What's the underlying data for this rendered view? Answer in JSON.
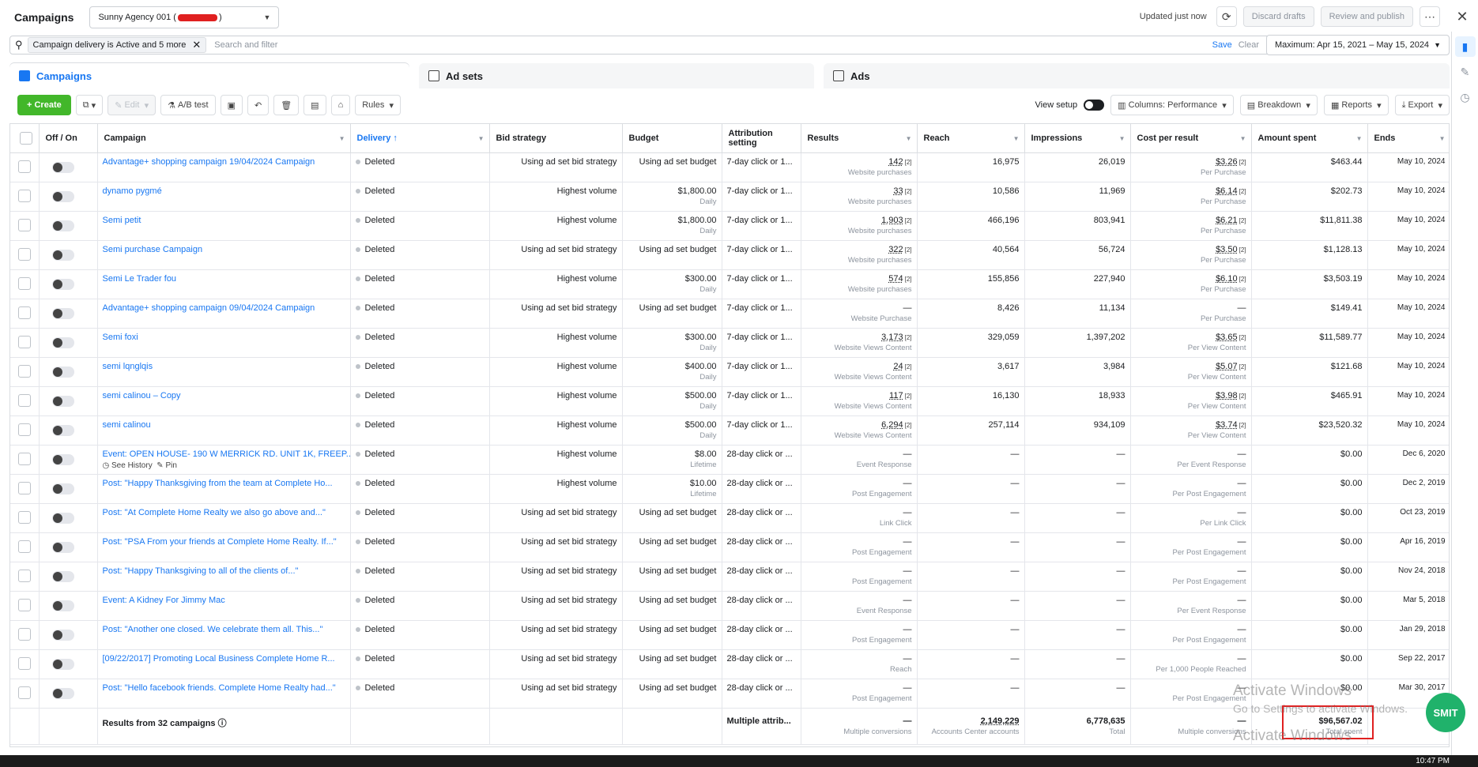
{
  "header": {
    "title": "Campaigns",
    "account": "Sunny Agency 001 (",
    "account_suffix": ")",
    "updated": "Updated just now",
    "discard": "Discard drafts",
    "review": "Review and publish"
  },
  "filter": {
    "chip_prefix": "Campaign delivery",
    "chip_is": "is",
    "chip_value": "Active and 5 more",
    "placeholder": "Search and filter",
    "save": "Save",
    "clear": "Clear",
    "date": "Maximum: Apr 15, 2021 – May 15, 2024"
  },
  "tabs": {
    "campaigns": "Campaigns",
    "adsets": "Ad sets",
    "ads": "Ads"
  },
  "toolbar": {
    "create": "+ Create",
    "edit": "Edit",
    "abtest": "A/B test",
    "rules": "Rules",
    "view_setup": "View setup",
    "columns": "Columns: Performance",
    "breakdown": "Breakdown",
    "reports": "Reports",
    "export": "Export"
  },
  "columns": [
    "Off / On",
    "Campaign",
    "Delivery",
    "Bid strategy",
    "Budget",
    "Attribution setting",
    "Results",
    "Reach",
    "Impressions",
    "Cost per result",
    "Amount spent",
    "Ends"
  ],
  "rows": [
    {
      "name": "Advantage+ shopping campaign 19/04/2024 Campaign",
      "delivery": "Deleted",
      "bid": "Using ad set bid strategy",
      "budget": "Using ad set budget",
      "budget_sub": "",
      "attr": "7-day click or 1...",
      "results": "142",
      "results_sub": "Website purchases",
      "reach": "16,975",
      "impr": "26,019",
      "cpr": "$3.26",
      "cpr_sub": "Per Purchase",
      "spent": "$463.44",
      "ends": "May 10, 2024"
    },
    {
      "name": "dynamo pygmé",
      "delivery": "Deleted",
      "bid": "Highest volume",
      "budget": "$1,800.00",
      "budget_sub": "Daily",
      "attr": "7-day click or 1...",
      "results": "33",
      "results_sub": "Website purchases",
      "reach": "10,586",
      "impr": "11,969",
      "cpr": "$6.14",
      "cpr_sub": "Per Purchase",
      "spent": "$202.73",
      "ends": "May 10, 2024"
    },
    {
      "name": "Semi petit",
      "delivery": "Deleted",
      "bid": "Highest volume",
      "budget": "$1,800.00",
      "budget_sub": "Daily",
      "attr": "7-day click or 1...",
      "results": "1,903",
      "results_sub": "Website purchases",
      "reach": "466,196",
      "impr": "803,941",
      "cpr": "$6.21",
      "cpr_sub": "Per Purchase",
      "spent": "$11,811.38",
      "ends": "May 10, 2024"
    },
    {
      "name": "Semi purchase Campaign",
      "delivery": "Deleted",
      "bid": "Using ad set bid strategy",
      "budget": "Using ad set budget",
      "budget_sub": "",
      "attr": "7-day click or 1...",
      "results": "322",
      "results_sub": "Website purchases",
      "reach": "40,564",
      "impr": "56,724",
      "cpr": "$3.50",
      "cpr_sub": "Per Purchase",
      "spent": "$1,128.13",
      "ends": "May 10, 2024"
    },
    {
      "name": "Semi Le Trader fou",
      "delivery": "Deleted",
      "bid": "Highest volume",
      "budget": "$300.00",
      "budget_sub": "Daily",
      "attr": "7-day click or 1...",
      "results": "574",
      "results_sub": "Website purchases",
      "reach": "155,856",
      "impr": "227,940",
      "cpr": "$6.10",
      "cpr_sub": "Per Purchase",
      "spent": "$3,503.19",
      "ends": "May 10, 2024"
    },
    {
      "name": "Advantage+ shopping campaign 09/04/2024 Campaign",
      "delivery": "Deleted",
      "bid": "Using ad set bid strategy",
      "budget": "Using ad set budget",
      "budget_sub": "",
      "attr": "7-day click or 1...",
      "results": "—",
      "results_sub": "Website Purchase",
      "reach": "8,426",
      "impr": "11,134",
      "cpr": "—",
      "cpr_sub": "Per Purchase",
      "spent": "$149.41",
      "ends": "May 10, 2024"
    },
    {
      "name": "Semi foxi",
      "delivery": "Deleted",
      "bid": "Highest volume",
      "budget": "$300.00",
      "budget_sub": "Daily",
      "attr": "7-day click or 1...",
      "results": "3,173",
      "results_sub": "Website Views Content",
      "reach": "329,059",
      "impr": "1,397,202",
      "cpr": "$3.65",
      "cpr_sub": "Per View Content",
      "spent": "$11,589.77",
      "ends": "May 10, 2024"
    },
    {
      "name": "semi lqnglqis",
      "delivery": "Deleted",
      "bid": "Highest volume",
      "budget": "$400.00",
      "budget_sub": "Daily",
      "attr": "7-day click or 1...",
      "results": "24",
      "results_sub": "Website Views Content",
      "reach": "3,617",
      "impr": "3,984",
      "cpr": "$5.07",
      "cpr_sub": "Per View Content",
      "spent": "$121.68",
      "ends": "May 10, 2024"
    },
    {
      "name": "semi calinou – Copy",
      "delivery": "Deleted",
      "bid": "Highest volume",
      "budget": "$500.00",
      "budget_sub": "Daily",
      "attr": "7-day click or 1...",
      "results": "117",
      "results_sub": "Website Views Content",
      "reach": "16,130",
      "impr": "18,933",
      "cpr": "$3.98",
      "cpr_sub": "Per View Content",
      "spent": "$465.91",
      "ends": "May 10, 2024"
    },
    {
      "name": "semi calinou",
      "delivery": "Deleted",
      "bid": "Highest volume",
      "budget": "$500.00",
      "budget_sub": "Daily",
      "attr": "7-day click or 1...",
      "results": "6,294",
      "results_sub": "Website Views Content",
      "reach": "257,114",
      "impr": "934,109",
      "cpr": "$3.74",
      "cpr_sub": "Per View Content",
      "spent": "$23,520.32",
      "ends": "May 10, 2024"
    },
    {
      "name": "Event: OPEN HOUSE- 190 W MERRICK RD. UNIT 1K, FREEP...",
      "extra1": "See History",
      "extra2": "Pin",
      "delivery": "Deleted",
      "bid": "Highest volume",
      "budget": "$8.00",
      "budget_sub": "Lifetime",
      "attr": "28-day click or ...",
      "results": "—",
      "results_sub": "Event Response",
      "reach": "—",
      "impr": "—",
      "cpr": "—",
      "cpr_sub": "Per Event Response",
      "spent": "$0.00",
      "ends": "Dec 6, 2020"
    },
    {
      "name": "Post: \"Happy Thanksgiving from the team at Complete Ho...",
      "delivery": "Deleted",
      "bid": "Highest volume",
      "budget": "$10.00",
      "budget_sub": "Lifetime",
      "attr": "28-day click or ...",
      "results": "—",
      "results_sub": "Post Engagement",
      "reach": "—",
      "impr": "—",
      "cpr": "—",
      "cpr_sub": "Per Post Engagement",
      "spent": "$0.00",
      "ends": "Dec 2, 2019"
    },
    {
      "name": "Post: \"At Complete Home Realty we also go above and...\"",
      "delivery": "Deleted",
      "bid": "Using ad set bid strategy",
      "budget": "Using ad set budget",
      "budget_sub": "",
      "attr": "28-day click or ...",
      "results": "—",
      "results_sub": "Link Click",
      "reach": "—",
      "impr": "—",
      "cpr": "—",
      "cpr_sub": "Per Link Click",
      "spent": "$0.00",
      "ends": "Oct 23, 2019"
    },
    {
      "name": "Post: \"PSA From your friends at Complete Home Realty. If...\"",
      "delivery": "Deleted",
      "bid": "Using ad set bid strategy",
      "budget": "Using ad set budget",
      "budget_sub": "",
      "attr": "28-day click or ...",
      "results": "—",
      "results_sub": "Post Engagement",
      "reach": "—",
      "impr": "—",
      "cpr": "—",
      "cpr_sub": "Per Post Engagement",
      "spent": "$0.00",
      "ends": "Apr 16, 2019"
    },
    {
      "name": "Post: \"Happy Thanksgiving to all of the clients of...\"",
      "delivery": "Deleted",
      "bid": "Using ad set bid strategy",
      "budget": "Using ad set budget",
      "budget_sub": "",
      "attr": "28-day click or ...",
      "results": "—",
      "results_sub": "Post Engagement",
      "reach": "—",
      "impr": "—",
      "cpr": "—",
      "cpr_sub": "Per Post Engagement",
      "spent": "$0.00",
      "ends": "Nov 24, 2018"
    },
    {
      "name": "Event: A Kidney For Jimmy Mac",
      "delivery": "Deleted",
      "bid": "Using ad set bid strategy",
      "budget": "Using ad set budget",
      "budget_sub": "",
      "attr": "28-day click or ...",
      "results": "—",
      "results_sub": "Event Response",
      "reach": "—",
      "impr": "—",
      "cpr": "—",
      "cpr_sub": "Per Event Response",
      "spent": "$0.00",
      "ends": "Mar 5, 2018"
    },
    {
      "name": "Post: \"Another one closed. We celebrate them all. This...\"",
      "delivery": "Deleted",
      "bid": "Using ad set bid strategy",
      "budget": "Using ad set budget",
      "budget_sub": "",
      "attr": "28-day click or ...",
      "results": "—",
      "results_sub": "Post Engagement",
      "reach": "—",
      "impr": "—",
      "cpr": "—",
      "cpr_sub": "Per Post Engagement",
      "spent": "$0.00",
      "ends": "Jan 29, 2018"
    },
    {
      "name": "[09/22/2017] Promoting Local Business Complete Home R...",
      "delivery": "Deleted",
      "bid": "Using ad set bid strategy",
      "budget": "Using ad set budget",
      "budget_sub": "",
      "attr": "28-day click or ...",
      "results": "—",
      "results_sub": "Reach",
      "reach": "—",
      "impr": "—",
      "cpr": "—",
      "cpr_sub": "Per 1,000 People Reached",
      "spent": "$0.00",
      "ends": "Sep 22, 2017"
    },
    {
      "name": "Post: \"Hello facebook friends. Complete Home Realty had...\"",
      "delivery": "Deleted",
      "bid": "Using ad set bid strategy",
      "budget": "Using ad set budget",
      "budget_sub": "",
      "attr": "28-day click or ...",
      "results": "—",
      "results_sub": "Post Engagement",
      "reach": "—",
      "impr": "—",
      "cpr": "—",
      "cpr_sub": "Per Post Engagement",
      "spent": "$0.00",
      "ends": "Mar 30, 2017"
    }
  ],
  "totals": {
    "label": "Results from 32 campaigns",
    "attr": "Multiple attrib...",
    "results": "—",
    "results_sub": "Multiple conversions",
    "reach": "2,149,229",
    "reach_sub": "Accounts Center accounts",
    "impr": "6,778,635",
    "impr_sub": "Total",
    "cpr": "—",
    "cpr_sub": "Multiple conversions",
    "spent": "$96,567.02",
    "spent_sub": "Total spent"
  },
  "overlay": {
    "watermark_title": "Activate Windows",
    "watermark_sub": "Go to Settings to activate Windows.",
    "smir": "SMIT",
    "clock": "10:47 PM"
  }
}
